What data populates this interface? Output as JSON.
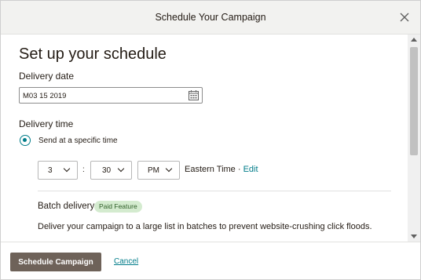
{
  "modal": {
    "title": "Schedule Your Campaign",
    "heading": "Set up your schedule"
  },
  "delivery_date": {
    "label": "Delivery date",
    "value": "M03 15 2019"
  },
  "delivery_time": {
    "label": "Delivery time",
    "option_label": "Send at a specific time",
    "hour": "3",
    "minute": "30",
    "meridiem": "PM",
    "timezone": "Eastern Time ·",
    "edit_link": "Edit"
  },
  "batch": {
    "label": "Batch delivery",
    "badge": "Paid Feature",
    "description": "Deliver your campaign to a large list in batches to prevent website-crushing click floods."
  },
  "footer": {
    "schedule_button": "Schedule Campaign",
    "cancel_link": "Cancel"
  },
  "colors": {
    "accent": "#007c89",
    "button": "#6e6259",
    "badge_bg": "#d4ebcf"
  }
}
